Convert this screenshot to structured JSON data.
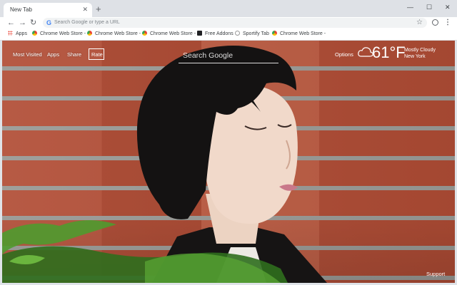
{
  "tab": {
    "title": "New Tab",
    "close": "✕"
  },
  "tabstrip": {
    "new_tab": "+",
    "minimize": "—",
    "maximize": "☐",
    "close": "✕"
  },
  "toolbar": {
    "back": "←",
    "forward": "→",
    "reload": "↻",
    "omnibox_placeholder": "Search Google or type a URL",
    "star": "☆",
    "menu": "⋮"
  },
  "bookmarks": [
    {
      "label": "Apps",
      "icon": "apps-grid-icon"
    },
    {
      "label": "Chrome Web Store -",
      "icon": "chrome-web-store-icon"
    },
    {
      "label": "Chrome Web Store -",
      "icon": "chrome-web-store-icon"
    },
    {
      "label": "Chrome Web Store -",
      "icon": "chrome-web-store-icon"
    },
    {
      "label": "Free Addons",
      "icon": "addons-icon"
    },
    {
      "label": "Sportify Tab",
      "icon": "sportify-icon"
    },
    {
      "label": "Chrome Web Store -",
      "icon": "chrome-web-store-icon"
    }
  ],
  "page": {
    "links": [
      "Most Visited",
      "Apps",
      "Share"
    ],
    "rate": "Rate",
    "search_placeholder": "Search Google",
    "options": "Options",
    "weather": {
      "temperature": "61°F",
      "condition": "Mostly Cloudy",
      "location": "New York"
    },
    "support": "Support"
  }
}
